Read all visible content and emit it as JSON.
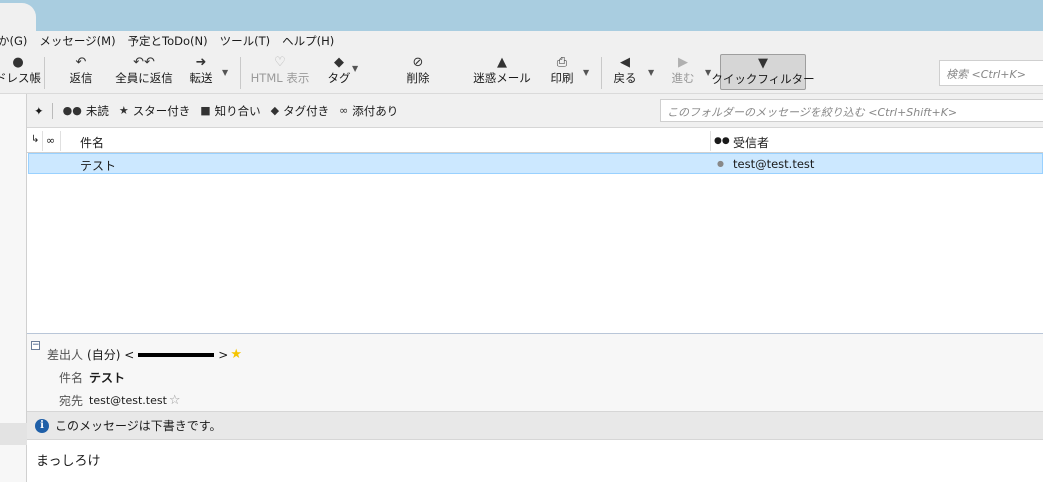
{
  "menubar": {
    "items": [
      "か(G)",
      "メッセージ(M)",
      "予定とToDo(N)",
      "ツール(T)",
      "ヘルプ(H)"
    ]
  },
  "toolbar": {
    "address_book": "ドレス帳",
    "reply": "返信",
    "reply_all": "全員に返信",
    "forward": "転送",
    "html_view": "HTML 表示",
    "tag": "タグ",
    "delete": "削除",
    "junk": "迷惑メール",
    "print": "印刷",
    "back": "戻る",
    "forward_nav": "進む",
    "quick_filter": "クイックフィルター"
  },
  "search": {
    "placeholder": "検索 <Ctrl+K>"
  },
  "quick_filter_bar": {
    "unread": "未読",
    "starred": "スター付き",
    "contacts": "知り合い",
    "tagged": "タグ付き",
    "attachment": "添付あり",
    "filter_placeholder": "このフォルダーのメッセージを絞り込む <Ctrl+Shift+K>"
  },
  "thread_pane": {
    "columns": {
      "subject": "件名",
      "recipient": "受信者"
    },
    "rows": [
      {
        "subject": "テスト",
        "recipient": "test@test.test",
        "selected": true
      }
    ]
  },
  "message_header": {
    "from_label": "差出人",
    "from_value_prefix": "(自分) <",
    "from_value_suffix": ">",
    "subject_label": "件名",
    "subject_value": "テスト",
    "to_label": "宛先",
    "to_value": "test@test.test"
  },
  "notice": {
    "text": "このメッセージは下書きです。"
  },
  "message_body": {
    "text": "まっしろけ"
  },
  "colors": {
    "titlebar": "#a9cde0",
    "selection": "#cce8ff",
    "info": "#1f5fa8",
    "star": "#f5c400"
  }
}
